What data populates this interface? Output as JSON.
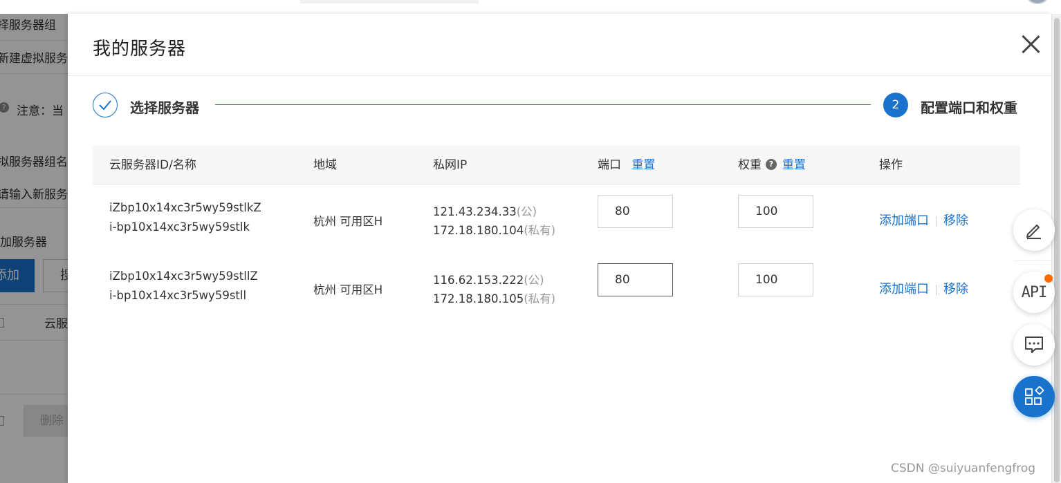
{
  "background": {
    "title_select_group": "择服务器组",
    "title_new_vserver": "新建虚拟服务",
    "notice": "注意：当",
    "label_vserver_group": "拟服务器组名",
    "input_placeholder": "请输入新服务",
    "section_add_server": "加服务器",
    "btn_add": "添加",
    "btn_search_partial": "搜",
    "col_cloud_partial": "云服",
    "btn_delete": "删除"
  },
  "dialog": {
    "title": "我的服务器",
    "steps": [
      {
        "label": "选择服务器",
        "state": "done"
      },
      {
        "number": "2",
        "label": "配置端口和权重",
        "state": "active"
      }
    ],
    "table": {
      "headers": {
        "id_name": "云服务器ID/名称",
        "region": "地域",
        "private_ip": "私网IP",
        "port": "端口",
        "port_reset": "重置",
        "weight": "权重",
        "weight_help": "?",
        "weight_reset": "重置",
        "actions": "操作"
      },
      "rows": [
        {
          "name": "iZbp10x14xc3r5wy59stlkZ",
          "id": "i-bp10x14xc3r5wy59stlk",
          "region": "杭州 可用区H",
          "public_ip": "121.43.234.33",
          "public_suffix": "(公)",
          "private_ip": "172.18.180.104",
          "private_suffix": "(私有)",
          "port": "80",
          "weight": "100",
          "add_port": "添加端口",
          "remove": "移除"
        },
        {
          "name": "iZbp10x14xc3r5wy59stllZ",
          "id": "i-bp10x14xc3r5wy59stll",
          "region": "杭州 可用区H",
          "public_ip": "116.62.153.222",
          "public_suffix": "(公)",
          "private_ip": "172.18.180.105",
          "private_suffix": "(私有)",
          "port": "80",
          "weight": "100",
          "add_port": "添加端口",
          "remove": "移除"
        }
      ]
    }
  },
  "float_tools": {
    "api_label": "API",
    "icons": [
      "edit-icon",
      "api-icon",
      "chat-icon",
      "apps-icon"
    ]
  },
  "watermark": "CSDN @suiyuanfengfrog",
  "colors": {
    "accent": "#1973cc",
    "badge": "#ff6a00"
  }
}
